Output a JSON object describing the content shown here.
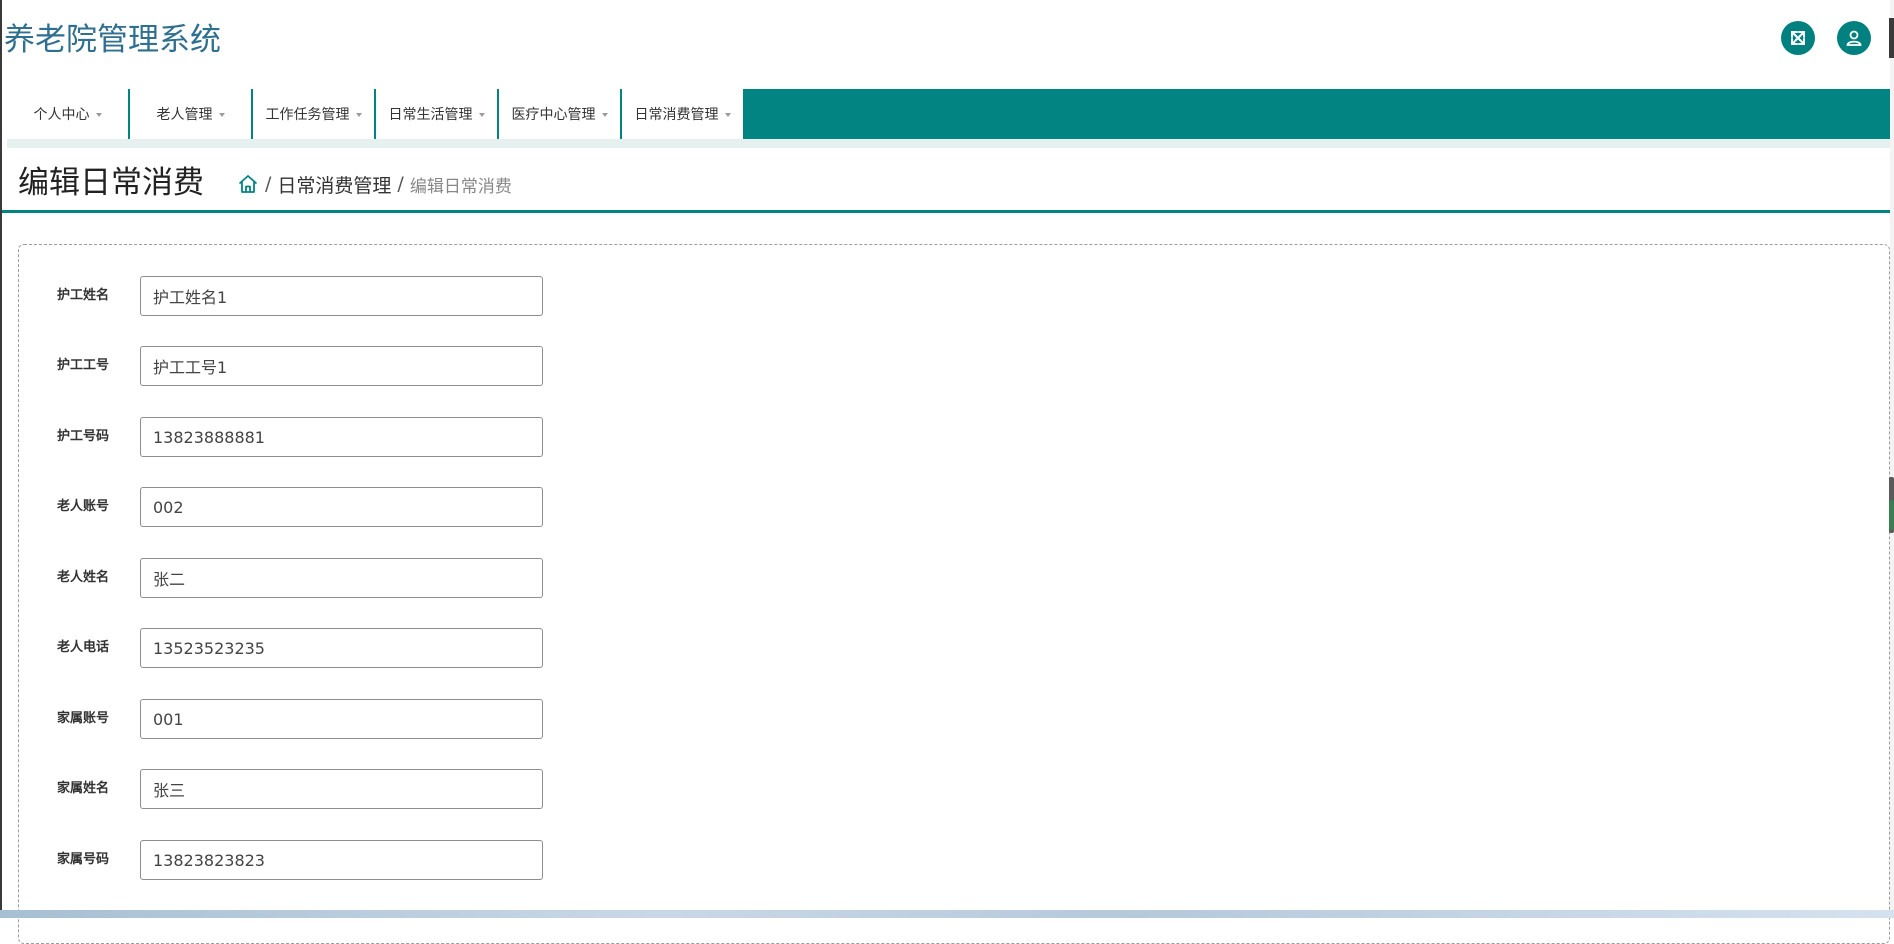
{
  "header": {
    "app_title": "养老院管理系统",
    "fullscreen_icon": "fullscreen-expand-icon",
    "user_icon": "user-icon",
    "accent_color": "#00817f",
    "title_color": "#2f6f8f"
  },
  "nav": {
    "bar_color": "#028482",
    "items": [
      {
        "label": "个人中心"
      },
      {
        "label": "老人管理"
      },
      {
        "label": "工作任务管理"
      },
      {
        "label": "日常生活管理"
      },
      {
        "label": "医疗中心管理"
      },
      {
        "label": "日常消费管理"
      }
    ]
  },
  "page": {
    "title": "编辑日常消费",
    "breadcrumb": {
      "home_icon": "home-icon",
      "separator": "/",
      "section": "日常消费管理",
      "current": "编辑日常消费"
    }
  },
  "form": {
    "fields": [
      {
        "label": "护工姓名",
        "value": "护工姓名1"
      },
      {
        "label": "护工工号",
        "value": "护工工号1"
      },
      {
        "label": "护工号码",
        "value": "13823888881"
      },
      {
        "label": "老人账号",
        "value": "002"
      },
      {
        "label": "老人姓名",
        "value": "张二"
      },
      {
        "label": "老人电话",
        "value": "13523523235"
      },
      {
        "label": "家属账号",
        "value": "001"
      },
      {
        "label": "家属姓名",
        "value": "张三"
      },
      {
        "label": "家属号码",
        "value": "13823823823"
      }
    ]
  }
}
